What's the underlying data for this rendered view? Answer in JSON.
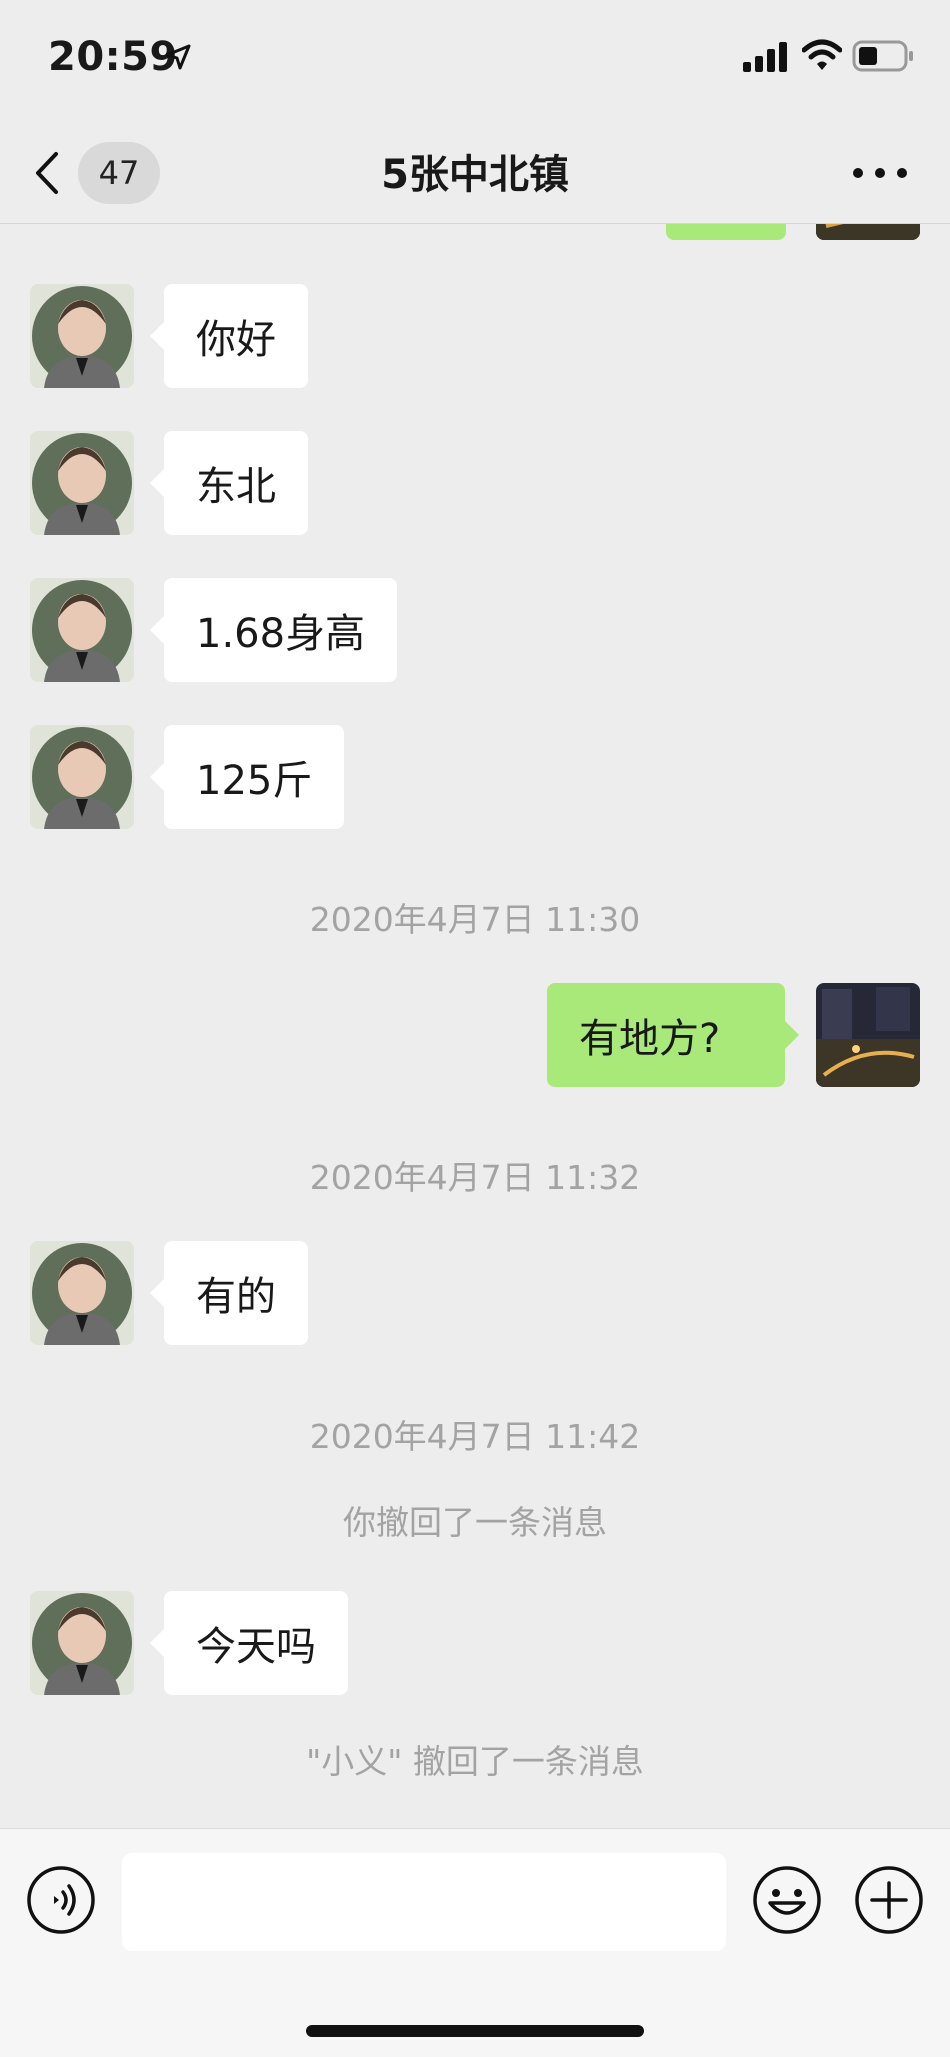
{
  "status_bar": {
    "time": "20:59"
  },
  "nav": {
    "unread_count": "47",
    "title": "5张中北镇"
  },
  "messages": {
    "m1": "你好",
    "m2": "东北",
    "m3": "1.68身高",
    "m4": "125斤",
    "ts1": "2020年4月7日 11:30",
    "m5": "有地方?",
    "ts2": "2020年4月7日 11:32",
    "m6": "有的",
    "ts3": "2020年4月7日 11:42",
    "recall_self": "你撤回了一条消息",
    "m7": "今天吗",
    "recall_other": "\"小义\" 撤回了一条消息"
  },
  "colors": {
    "sent_bubble": "#a9e97a",
    "received_bubble": "#ffffff",
    "background": "#ededed"
  },
  "icons": [
    "location-arrow-icon",
    "signal-icon",
    "wifi-icon",
    "battery-icon",
    "back-icon",
    "more-icon",
    "voice-icon",
    "emoji-icon",
    "plus-icon"
  ]
}
